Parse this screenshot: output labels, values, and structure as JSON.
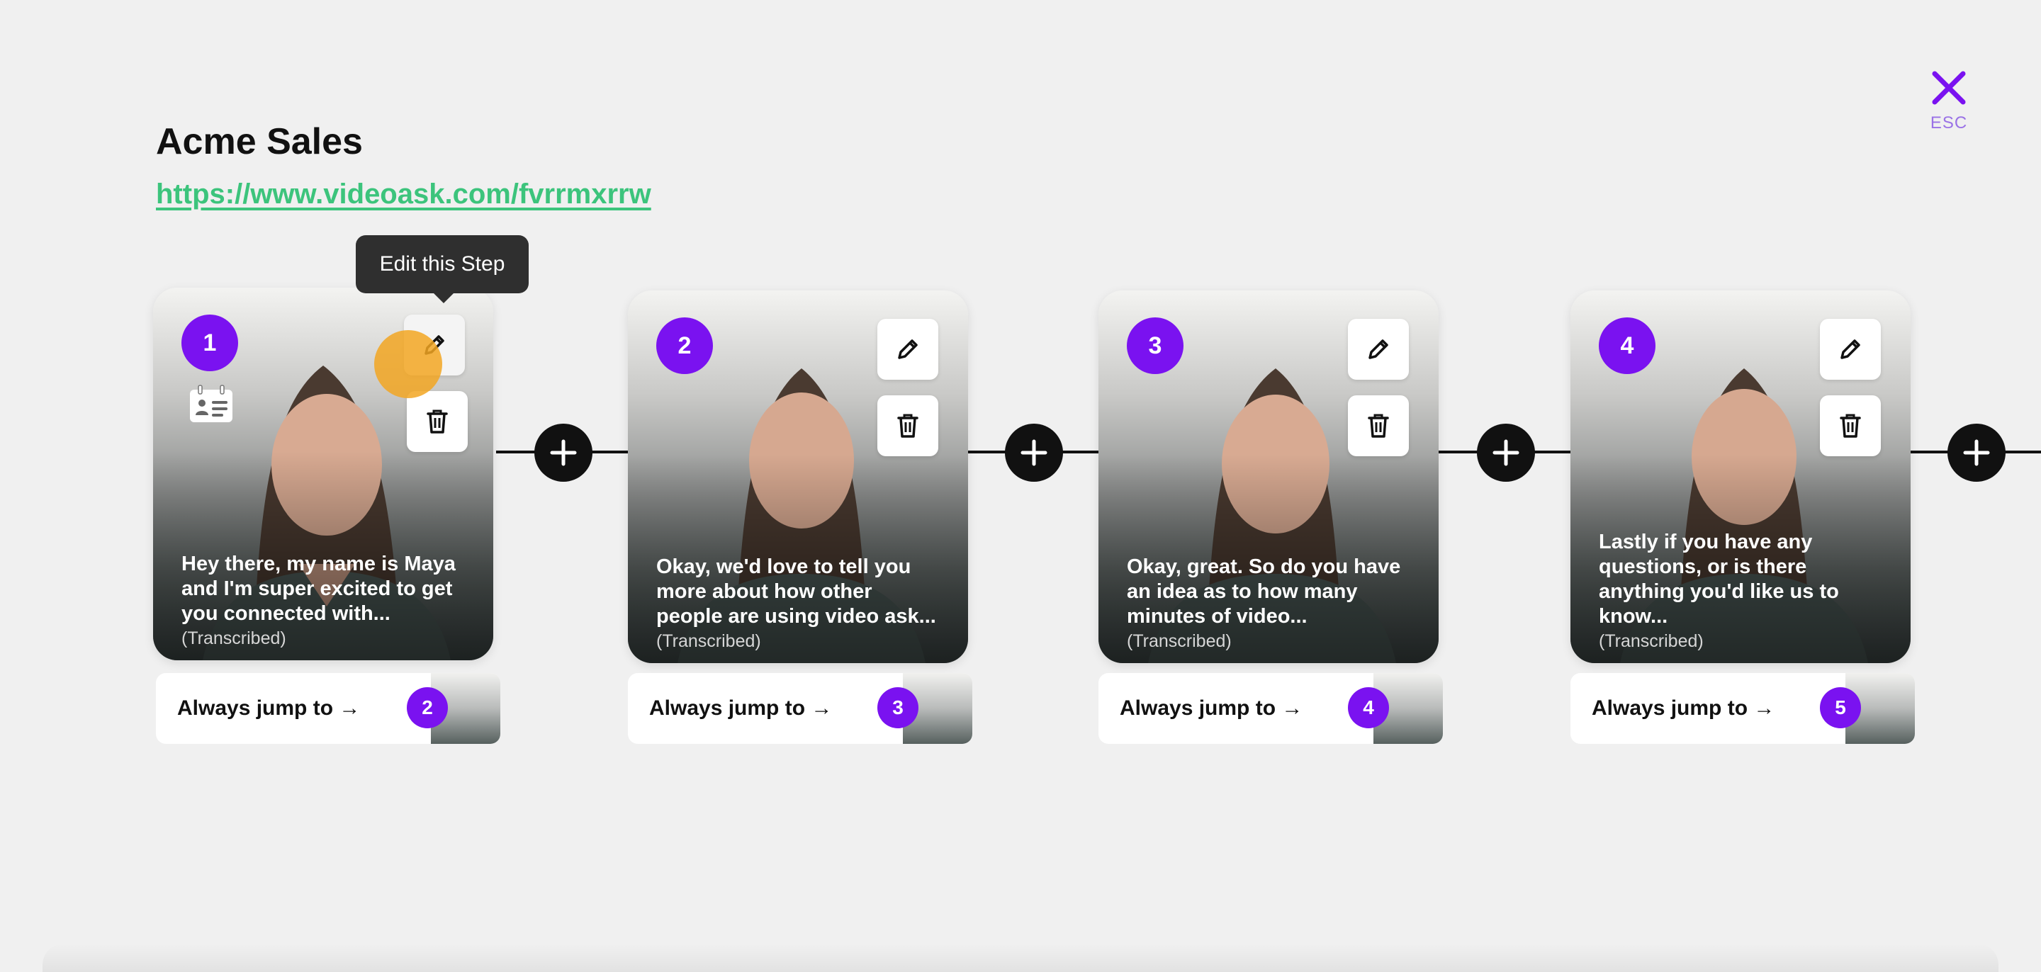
{
  "header": {
    "title": "Acme Sales",
    "link": "https://www.videoask.com/fvrrmxrrw"
  },
  "close": {
    "esc_label": "ESC"
  },
  "tooltip": {
    "text": "Edit this Step"
  },
  "colors": {
    "accent": "#7a12f0",
    "link": "#3cc47c",
    "close": "#7a12f0"
  },
  "icons": [
    "close-icon",
    "pencil-icon",
    "trash-icon",
    "plus-icon",
    "contact-card-icon"
  ],
  "steps": [
    {
      "number": "1",
      "text": "Hey there, my name is Maya and I'm super excited to get you connected with...",
      "transcribed": "(Transcribed)",
      "jump_label": "Always jump to →",
      "jump_target": "2"
    },
    {
      "number": "2",
      "text": "Okay, we'd love to tell you more about how other people are using video ask...",
      "transcribed": "(Transcribed)",
      "jump_label": "Always jump to →",
      "jump_target": "3"
    },
    {
      "number": "3",
      "text": "Okay, great. So do you have an idea as to how many minutes of video...",
      "transcribed": "(Transcribed)",
      "jump_label": "Always jump to →",
      "jump_target": "4"
    },
    {
      "number": "4",
      "text": "Lastly if you have any questions, or is there anything you'd like us to know...",
      "transcribed": "(Transcribed)",
      "jump_label": "Always jump to →",
      "jump_target": "5"
    }
  ]
}
